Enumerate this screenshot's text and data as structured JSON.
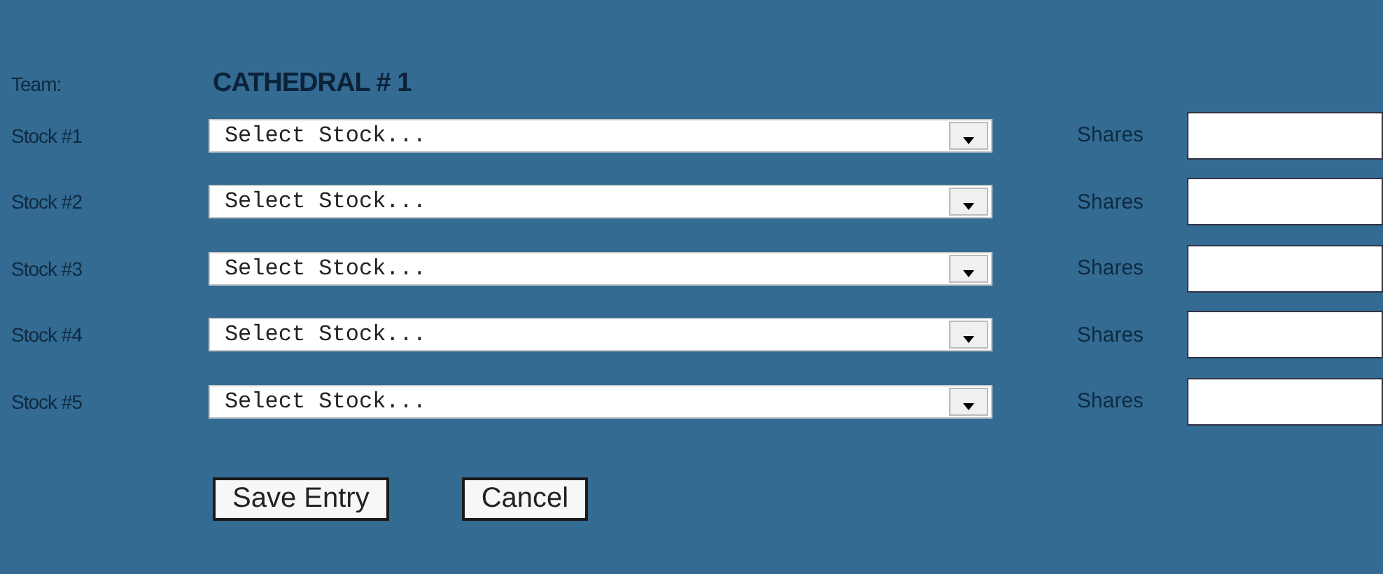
{
  "team": {
    "label": "Team:",
    "name": "CATHEDRAL # 1"
  },
  "stocks": [
    {
      "label": "Stock #1",
      "placeholder": "Select Stock...",
      "shares_label": "Shares"
    },
    {
      "label": "Stock #2",
      "placeholder": "Select Stock...",
      "shares_label": "Shares"
    },
    {
      "label": "Stock #3",
      "placeholder": "Select Stock...",
      "shares_label": "Shares"
    },
    {
      "label": "Stock #4",
      "placeholder": "Select Stock...",
      "shares_label": "Shares"
    },
    {
      "label": "Stock #5",
      "placeholder": "Select Stock...",
      "shares_label": "Shares"
    }
  ],
  "buttons": [
    "Save Entry",
    "Cancel"
  ]
}
